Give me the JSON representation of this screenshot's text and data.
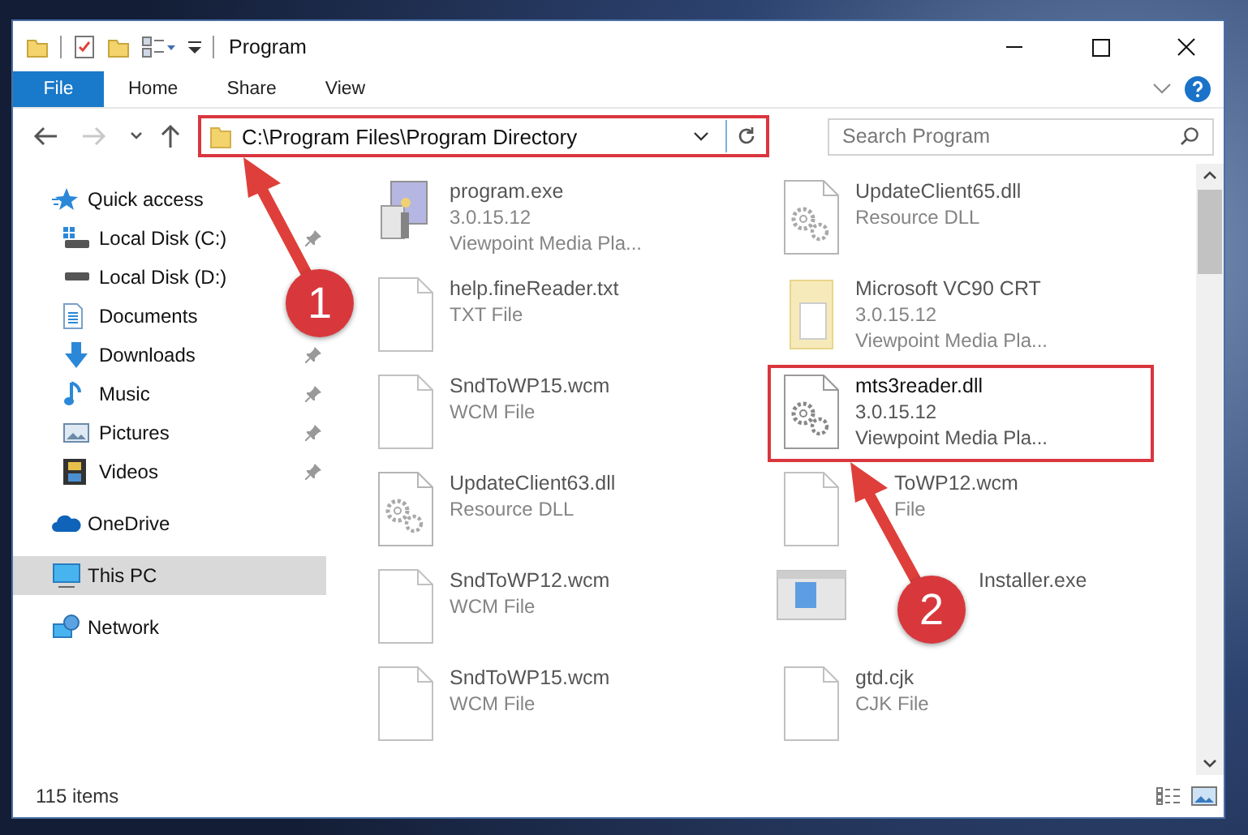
{
  "window": {
    "title": "Program"
  },
  "ribbon_tabs": [
    {
      "label": "File",
      "kind": "file",
      "selected": false
    },
    {
      "label": "Home",
      "kind": "tab",
      "selected": false
    },
    {
      "label": "Share",
      "kind": "tab",
      "selected": false
    },
    {
      "label": "View",
      "kind": "tab",
      "selected": false
    }
  ],
  "nav_buttons": [
    {
      "kind": "back",
      "disabled": false
    },
    {
      "kind": "forward",
      "disabled": true
    },
    {
      "kind": "recent",
      "disabled": false
    },
    {
      "kind": "up",
      "disabled": false
    }
  ],
  "address": {
    "path": "C:\\Program Files\\Program Directory",
    "highlighted": true
  },
  "search": {
    "placeholder": "Search Program"
  },
  "sidebar": {
    "items": [
      {
        "label": "Quick access",
        "kind": "star",
        "selected": false,
        "children": [
          {
            "label": "Local Disk (C:)",
            "kind": "drive-c",
            "pinned": true
          },
          {
            "label": "Local Disk (D:)",
            "kind": "drive",
            "pinned": false
          },
          {
            "label": "Documents",
            "kind": "documents",
            "pinned": false
          },
          {
            "label": "Downloads",
            "kind": "downloads",
            "pinned": true
          },
          {
            "label": "Music",
            "kind": "music",
            "pinned": true
          },
          {
            "label": "Pictures",
            "kind": "pictures",
            "pinned": true
          },
          {
            "label": "Videos",
            "kind": "videos",
            "pinned": true
          }
        ]
      },
      {
        "label": "OneDrive",
        "kind": "cloud",
        "selected": false
      },
      {
        "label": "This PC",
        "kind": "pc",
        "selected": true
      },
      {
        "label": "Network",
        "kind": "network",
        "selected": false
      }
    ]
  },
  "files": [
    {
      "name": "program.exe",
      "details": [
        "3.0.15.12",
        "Viewpoint Media Pla..."
      ],
      "kind": "exe",
      "faded": true,
      "highlighted": false
    },
    {
      "name": "UpdateClient65.dll",
      "details": [
        "Resource DLL"
      ],
      "kind": "dll",
      "faded": true,
      "highlighted": false
    },
    {
      "name": "help.fineReader.txt",
      "details": [
        "TXT File"
      ],
      "kind": "file",
      "faded": true,
      "highlighted": false
    },
    {
      "name": "Microsoft VC90 CRT",
      "details": [
        "3.0.15.12",
        "Viewpoint Media Pla..."
      ],
      "kind": "manifest",
      "faded": true,
      "highlighted": false
    },
    {
      "name": "SndToWP15.wcm",
      "details": [
        "WCM File"
      ],
      "kind": "file",
      "faded": true,
      "highlighted": false
    },
    {
      "name": "mts3reader.dll",
      "details": [
        "3.0.15.12",
        "Viewpoint Media Pla..."
      ],
      "kind": "dll",
      "faded": false,
      "highlighted": true
    },
    {
      "name": "UpdateClient63.dll",
      "details": [
        "Resource DLL"
      ],
      "kind": "dll",
      "faded": true,
      "highlighted": false
    },
    {
      "name": "ToWP12.wcm",
      "details": [
        "File"
      ],
      "kind": "file",
      "faded": true,
      "highlighted": false
    },
    {
      "name": "SndToWP12.wcm",
      "details": [
        "WCM File"
      ],
      "kind": "file",
      "faded": true,
      "highlighted": false
    },
    {
      "name": "Installer.exe",
      "kind": "installer",
      "faded": true,
      "highlighted": false
    },
    {
      "name": "SndToWP15.wcm",
      "details": [
        "WCM File"
      ],
      "kind": "file",
      "faded": true,
      "highlighted": false
    },
    {
      "name": "gtd.cjk",
      "details": [
        "CJK File"
      ],
      "kind": "file",
      "faded": true,
      "highlighted": false
    }
  ],
  "status_bar": {
    "item_count": "115 items"
  },
  "annotations": [
    {
      "label": "1"
    },
    {
      "label": "2"
    }
  ]
}
